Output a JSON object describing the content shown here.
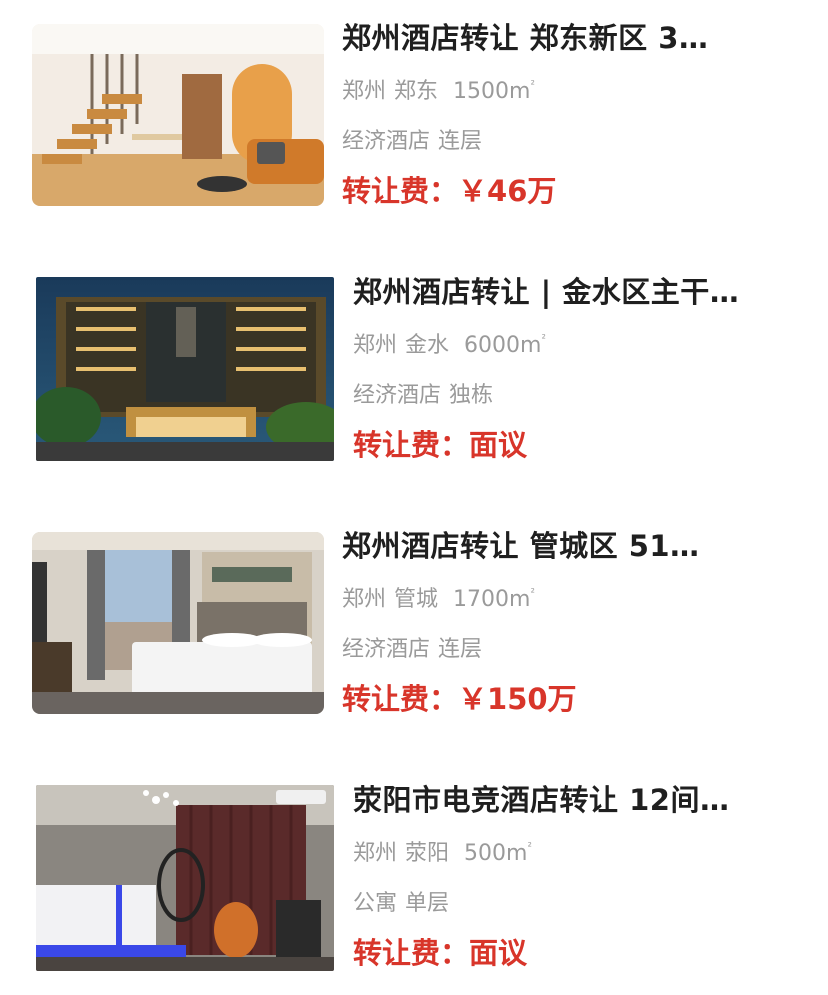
{
  "listings": [
    {
      "title": "郑州酒店转让 郑东新区 3…",
      "city": "郑州",
      "district": "郑东",
      "area": "1500m",
      "area_unit_sup": "²",
      "type": "经济酒店",
      "floor": "连层",
      "price_label": "转让费：",
      "price_value": "￥46万",
      "image": "loft-room-photo"
    },
    {
      "title": "郑州酒店转让 | 金水区主干…",
      "city": "郑州",
      "district": "金水",
      "area": "6000m",
      "area_unit_sup": "²",
      "type": "经济酒店",
      "floor": "独栋",
      "price_label": "转让费：",
      "price_value": "面议",
      "image": "hotel-building-night-photo"
    },
    {
      "title": "郑州酒店转让 管城区 51…",
      "city": "郑州",
      "district": "管城",
      "area": "1700m",
      "area_unit_sup": "²",
      "type": "经济酒店",
      "floor": "连层",
      "price_label": "转让费：",
      "price_value": "￥150万",
      "image": "hotel-bedroom-photo"
    },
    {
      "title": "荥阳市电竞酒店转让 12间…",
      "city": "郑州",
      "district": "荥阳",
      "area": "500m",
      "area_unit_sup": "²",
      "type": "公寓",
      "floor": "单层",
      "price_label": "转让费：",
      "price_value": "面议",
      "image": "esports-room-photo"
    }
  ],
  "colors": {
    "price": "#d8352a",
    "title": "#1f1f1f",
    "meta": "#9a9a9a"
  }
}
